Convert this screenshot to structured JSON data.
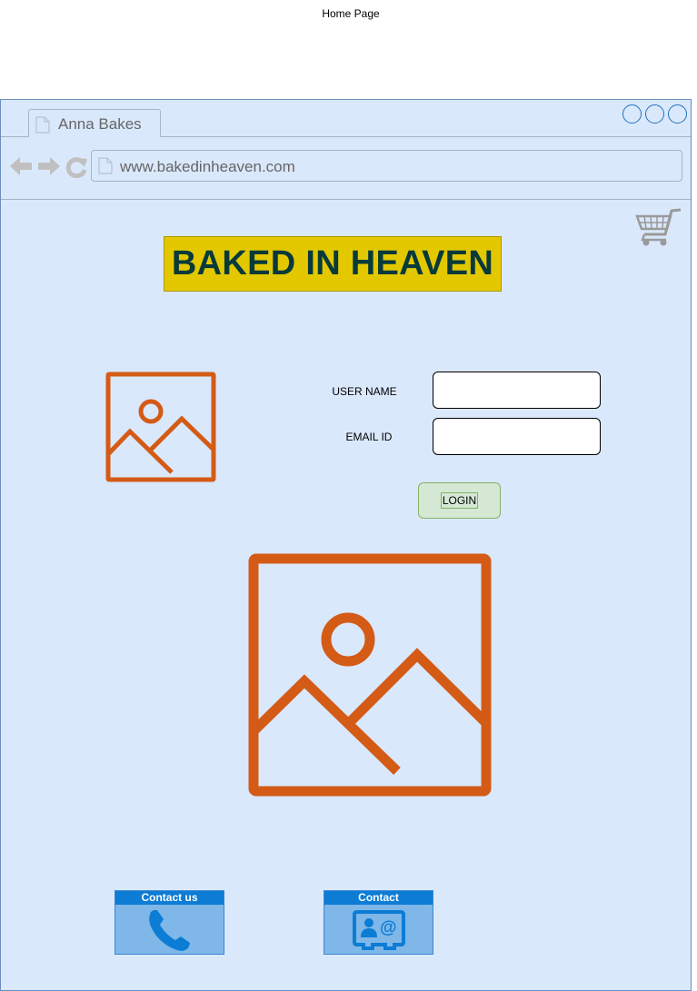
{
  "page": {
    "caption": "Home Page"
  },
  "browser": {
    "tab_title": "Anna Bakes",
    "url": "www.bakedinheaven.com"
  },
  "site": {
    "brand": "BAKED IN HEAVEN"
  },
  "login_form": {
    "username_label": "USER NAME",
    "username_value": "",
    "email_label": "EMAIL ID",
    "email_value": "",
    "login_label": "LOGIN"
  },
  "contact": {
    "phone_label": "Contact us",
    "email_label": "Contact"
  },
  "colors": {
    "browser_bg": "#dae8fc",
    "brand_bg": "#e3c800",
    "brand_text": "#083a3a",
    "placeholder_orange": "#d45b16",
    "login_bg": "#d5e8d4",
    "tile_header": "#0c7cd5",
    "tile_body": "#7eb7e8"
  }
}
